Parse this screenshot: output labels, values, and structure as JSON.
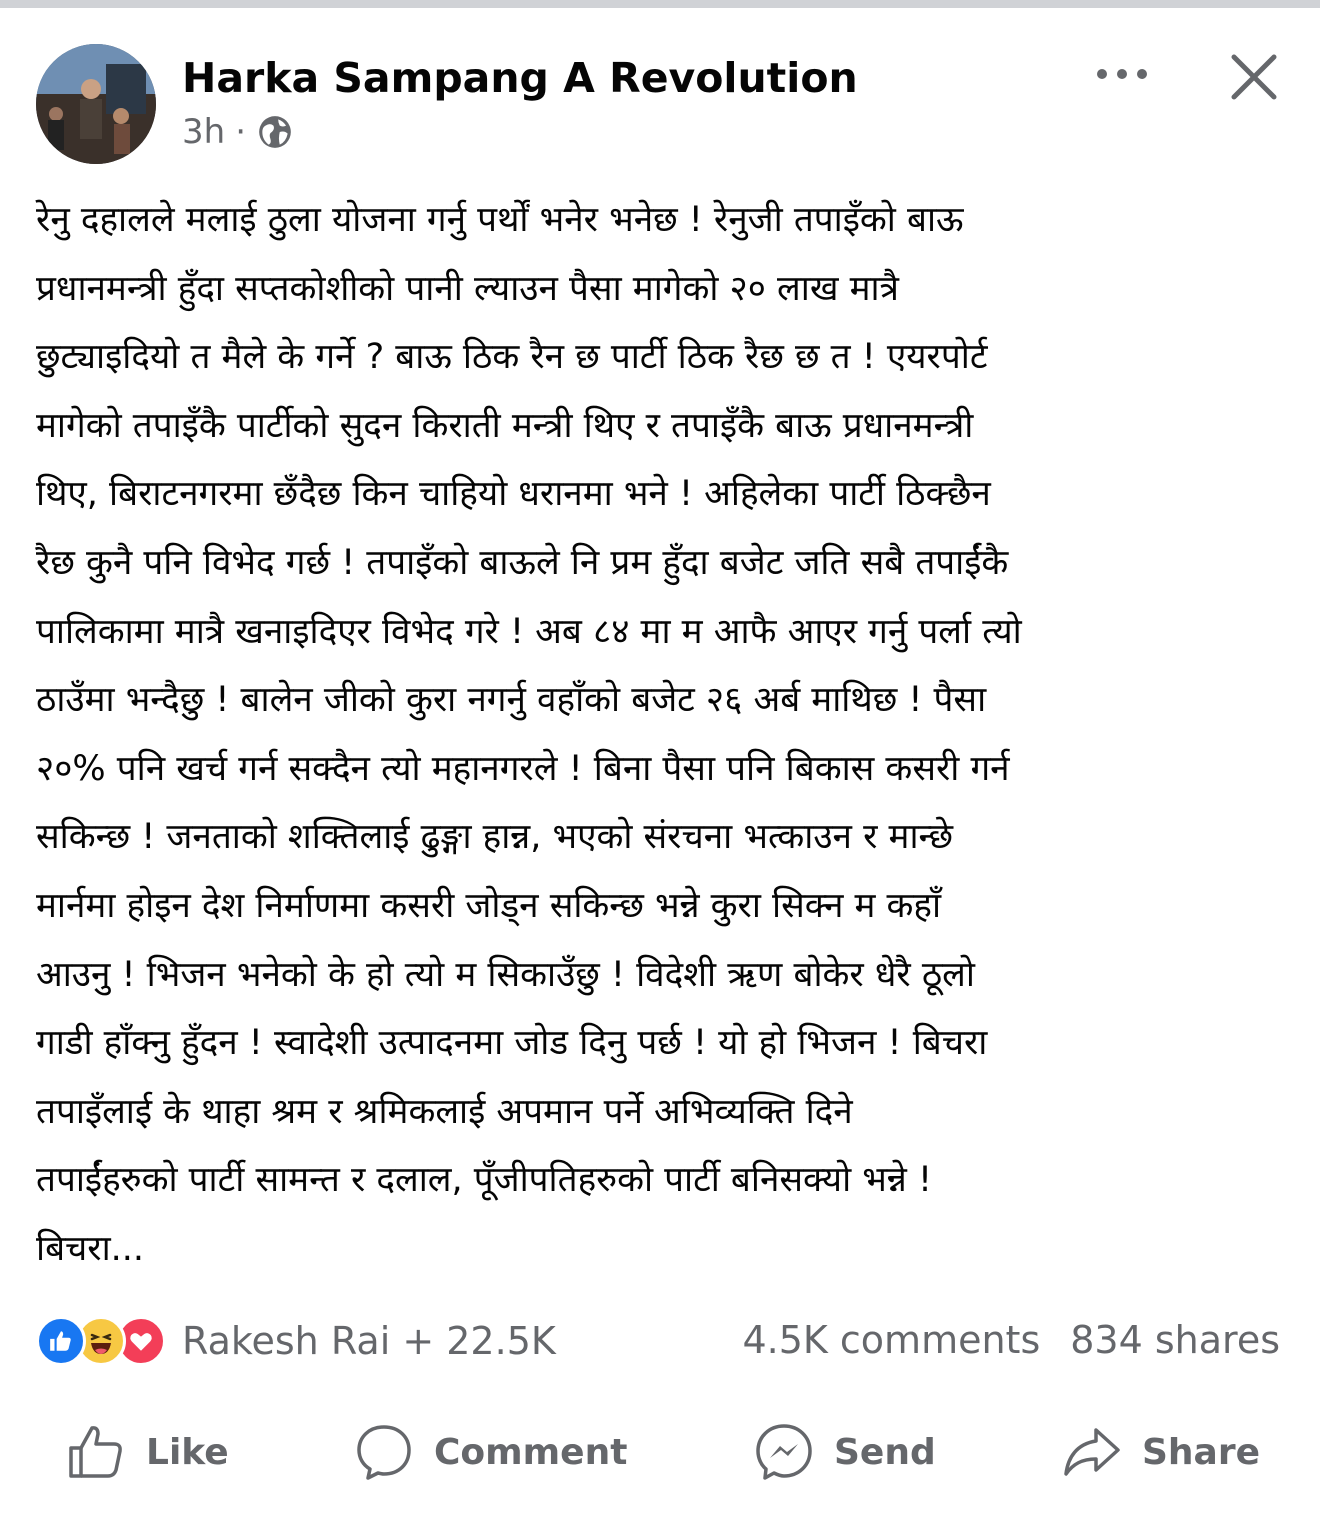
{
  "post": {
    "author": "Harka Sampang A Revolution",
    "time": "3h",
    "separator": "·",
    "text": "रेनु दहालले मलाई ठुला योजना गर्नु पर्थों भनेर भनेछ ! रेनुजी तपाइँको बाऊ\nप्रधानमन्त्री हुँदा सप्तकोशीको पानी ल्याउन पैसा मागेको २० लाख मात्रै\nछुट्याइदियो त मैले के गर्ने ? बाऊ ठिक रैन छ पार्टी ठिक रैछ छ त ! एयरपोर्ट\nमागेको तपाइँकै पार्टीको सुदन किराती मन्त्री थिए र तपाइँकै बाऊ प्रधानमन्त्री\nथिए, बिराटनगरमा छँदैछ किन चाहियो धरानमा भने ! अहिलेका पार्टी ठिक्छैन\nरैछ कुनै पनि विभेद गर्छ ! तपाइँको बाऊले नि प्रम हुँदा बजेट जति सबै तपाईंकै\nपालिकामा मात्रै खनाइदिएर विभेद गरे ! अब ८४ मा म आफै आएर गर्नु पर्ला त्यो\nठाउँमा भन्दैछु ! बालेन जीको कुरा नगर्नु वहाँको बजेट २६ अर्ब माथिछ ! पैसा\n२०% पनि खर्च गर्न सक्दैन त्यो महानगरले ! बिना पैसा पनि बिकास कसरी गर्न\nसकिन्छ ! जनताको शक्तिलाई ढुङ्गा हान्न, भएको संरचना भत्काउन र मान्छे\nमार्नमा होइन देश निर्माणमा कसरी जोड्न सकिन्छ भन्ने कुरा सिक्न म कहाँ\nआउनु ! भिजन भनेको के हो त्यो म सिकाउँछु ! विदेशी ऋण बोकेर धेरै ठूलो\nगाडी हाँक्नु हुँदन ! स्वादेशी उत्पादनमा जोड दिनु पर्छ ! यो हो भिजन ! बिचरा\nतपाइँलाई के थाहा श्रम र श्रमिकलाई अपमान पर्ने अभिव्यक्ति दिने\nतपाईंहरुको पार्टी सामन्त र दलाल, पूँजीपतिहरुको पार्टी बनिसक्यो भन्ने !\nबिचरा..."
  },
  "reactions": {
    "summary": "Rakesh Rai + 22.5K",
    "icons": [
      "like-icon",
      "haha-icon",
      "love-icon"
    ]
  },
  "stats": {
    "comments": "4.5K comments",
    "shares": "834 shares"
  },
  "actions": {
    "like": "Like",
    "comment": "Comment",
    "send": "Send",
    "share": "Share"
  },
  "colors": {
    "text": "#050505",
    "secondary": "#65676b",
    "like_blue": "#1877f2",
    "love_red": "#f33e58",
    "haha_yellow": "#f7c843"
  }
}
